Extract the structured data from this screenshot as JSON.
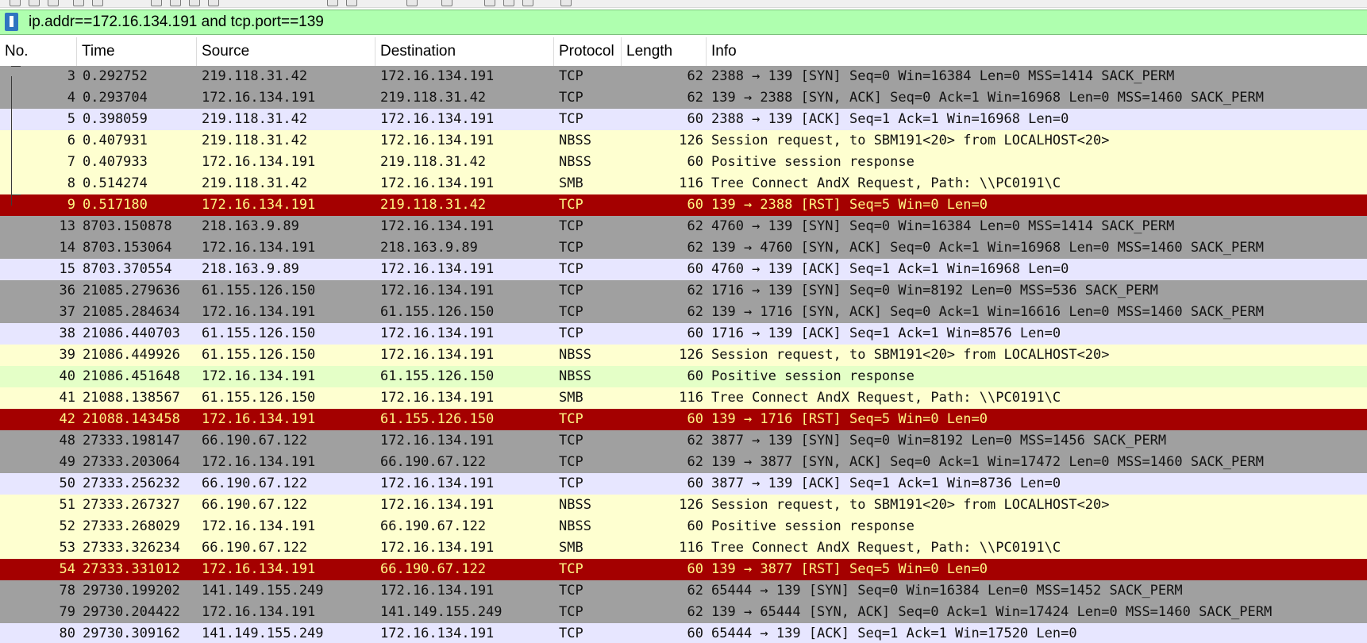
{
  "filter": {
    "value": "ip.addr==172.16.134.191 and tcp.port==139"
  },
  "columns": [
    "No.",
    "Time",
    "Source",
    "Destination",
    "Protocol",
    "Length",
    "Info"
  ],
  "colors": {
    "rst_bg": "#a40000",
    "rst_fg": "#fff785",
    "syn_bg": "#a0a0a0",
    "ack_bg": "#e7e6ff",
    "nbss_bg": "#feffd0",
    "nbss_alt_bg": "#e4ffc7",
    "filter_bg": "#afffaf"
  },
  "packets": [
    {
      "no": "3",
      "time": "0.292752",
      "src": "219.118.31.42",
      "dst": "172.16.134.191",
      "proto": "TCP",
      "len": "62",
      "info": "2388 → 139 [SYN] Seq=0 Win=16384 Len=0 MSS=1414 SACK_PERM",
      "style": "syn",
      "bracket": "start"
    },
    {
      "no": "4",
      "time": "0.293704",
      "src": "172.16.134.191",
      "dst": "219.118.31.42",
      "proto": "TCP",
      "len": "62",
      "info": "139 → 2388 [SYN, ACK] Seq=0 Ack=1 Win=16968 Len=0 MSS=1460 SACK_PERM",
      "style": "syn",
      "bracket": "mid"
    },
    {
      "no": "5",
      "time": "0.398059",
      "src": "219.118.31.42",
      "dst": "172.16.134.191",
      "proto": "TCP",
      "len": "60",
      "info": "2388 → 139 [ACK] Seq=1 Ack=1 Win=16968 Len=0",
      "style": "ack",
      "bracket": "mid"
    },
    {
      "no": "6",
      "time": "0.407931",
      "src": "219.118.31.42",
      "dst": "172.16.134.191",
      "proto": "NBSS",
      "len": "126",
      "info": "Session request, to SBM191<20> from LOCALHOST<20>",
      "style": "nbss",
      "bracket": "mid"
    },
    {
      "no": "7",
      "time": "0.407933",
      "src": "172.16.134.191",
      "dst": "219.118.31.42",
      "proto": "NBSS",
      "len": "60",
      "info": "Positive session response",
      "style": "nbss",
      "bracket": "mid"
    },
    {
      "no": "8",
      "time": "0.514274",
      "src": "219.118.31.42",
      "dst": "172.16.134.191",
      "proto": "SMB",
      "len": "116",
      "info": "Tree Connect AndX Request, Path: \\\\PC0191\\C",
      "style": "nbss",
      "bracket": "mid"
    },
    {
      "no": "9",
      "time": "0.517180",
      "src": "172.16.134.191",
      "dst": "219.118.31.42",
      "proto": "TCP",
      "len": "60",
      "info": "139 → 2388 [RST] Seq=5 Win=0 Len=0",
      "style": "rst",
      "bracket": "end"
    },
    {
      "no": "13",
      "time": "8703.150878",
      "src": "218.163.9.89",
      "dst": "172.16.134.191",
      "proto": "TCP",
      "len": "62",
      "info": "4760 → 139 [SYN] Seq=0 Win=16384 Len=0 MSS=1414 SACK_PERM",
      "style": "syn",
      "bracket": ""
    },
    {
      "no": "14",
      "time": "8703.153064",
      "src": "172.16.134.191",
      "dst": "218.163.9.89",
      "proto": "TCP",
      "len": "62",
      "info": "139 → 4760 [SYN, ACK] Seq=0 Ack=1 Win=16968 Len=0 MSS=1460 SACK_PERM",
      "style": "syn",
      "bracket": ""
    },
    {
      "no": "15",
      "time": "8703.370554",
      "src": "218.163.9.89",
      "dst": "172.16.134.191",
      "proto": "TCP",
      "len": "60",
      "info": "4760 → 139 [ACK] Seq=1 Ack=1 Win=16968 Len=0",
      "style": "ack",
      "bracket": ""
    },
    {
      "no": "36",
      "time": "21085.279636",
      "src": "61.155.126.150",
      "dst": "172.16.134.191",
      "proto": "TCP",
      "len": "62",
      "info": "1716 → 139 [SYN] Seq=0 Win=8192 Len=0 MSS=536 SACK_PERM",
      "style": "syn",
      "bracket": ""
    },
    {
      "no": "37",
      "time": "21085.284634",
      "src": "172.16.134.191",
      "dst": "61.155.126.150",
      "proto": "TCP",
      "len": "62",
      "info": "139 → 1716 [SYN, ACK] Seq=0 Ack=1 Win=16616 Len=0 MSS=1460 SACK_PERM",
      "style": "syn",
      "bracket": ""
    },
    {
      "no": "38",
      "time": "21086.440703",
      "src": "61.155.126.150",
      "dst": "172.16.134.191",
      "proto": "TCP",
      "len": "60",
      "info": "1716 → 139 [ACK] Seq=1 Ack=1 Win=8576 Len=0",
      "style": "ack",
      "bracket": ""
    },
    {
      "no": "39",
      "time": "21086.449926",
      "src": "61.155.126.150",
      "dst": "172.16.134.191",
      "proto": "NBSS",
      "len": "126",
      "info": "Session request, to SBM191<20> from LOCALHOST<20>",
      "style": "nbss",
      "bracket": ""
    },
    {
      "no": "40",
      "time": "21086.451648",
      "src": "172.16.134.191",
      "dst": "61.155.126.150",
      "proto": "NBSS",
      "len": "60",
      "info": "Positive session response",
      "style": "nbss_alt",
      "bracket": ""
    },
    {
      "no": "41",
      "time": "21088.138567",
      "src": "61.155.126.150",
      "dst": "172.16.134.191",
      "proto": "SMB",
      "len": "116",
      "info": "Tree Connect AndX Request, Path: \\\\PC0191\\C",
      "style": "nbss",
      "bracket": ""
    },
    {
      "no": "42",
      "time": "21088.143458",
      "src": "172.16.134.191",
      "dst": "61.155.126.150",
      "proto": "TCP",
      "len": "60",
      "info": "139 → 1716 [RST] Seq=5 Win=0 Len=0",
      "style": "rst",
      "bracket": ""
    },
    {
      "no": "48",
      "time": "27333.198147",
      "src": "66.190.67.122",
      "dst": "172.16.134.191",
      "proto": "TCP",
      "len": "62",
      "info": "3877 → 139 [SYN] Seq=0 Win=8192 Len=0 MSS=1456 SACK_PERM",
      "style": "syn",
      "bracket": ""
    },
    {
      "no": "49",
      "time": "27333.203064",
      "src": "172.16.134.191",
      "dst": "66.190.67.122",
      "proto": "TCP",
      "len": "62",
      "info": "139 → 3877 [SYN, ACK] Seq=0 Ack=1 Win=17472 Len=0 MSS=1460 SACK_PERM",
      "style": "syn",
      "bracket": ""
    },
    {
      "no": "50",
      "time": "27333.256232",
      "src": "66.190.67.122",
      "dst": "172.16.134.191",
      "proto": "TCP",
      "len": "60",
      "info": "3877 → 139 [ACK] Seq=1 Ack=1 Win=8736 Len=0",
      "style": "ack",
      "bracket": ""
    },
    {
      "no": "51",
      "time": "27333.267327",
      "src": "66.190.67.122",
      "dst": "172.16.134.191",
      "proto": "NBSS",
      "len": "126",
      "info": "Session request, to SBM191<20> from LOCALHOST<20>",
      "style": "nbss",
      "bracket": ""
    },
    {
      "no": "52",
      "time": "27333.268029",
      "src": "172.16.134.191",
      "dst": "66.190.67.122",
      "proto": "NBSS",
      "len": "60",
      "info": "Positive session response",
      "style": "nbss",
      "bracket": ""
    },
    {
      "no": "53",
      "time": "27333.326234",
      "src": "66.190.67.122",
      "dst": "172.16.134.191",
      "proto": "SMB",
      "len": "116",
      "info": "Tree Connect AndX Request, Path: \\\\PC0191\\C",
      "style": "nbss",
      "bracket": ""
    },
    {
      "no": "54",
      "time": "27333.331012",
      "src": "172.16.134.191",
      "dst": "66.190.67.122",
      "proto": "TCP",
      "len": "60",
      "info": "139 → 3877 [RST] Seq=5 Win=0 Len=0",
      "style": "rst",
      "bracket": ""
    },
    {
      "no": "78",
      "time": "29730.199202",
      "src": "141.149.155.249",
      "dst": "172.16.134.191",
      "proto": "TCP",
      "len": "62",
      "info": "65444 → 139 [SYN] Seq=0 Win=16384 Len=0 MSS=1452 SACK_PERM",
      "style": "syn",
      "bracket": ""
    },
    {
      "no": "79",
      "time": "29730.204422",
      "src": "172.16.134.191",
      "dst": "141.149.155.249",
      "proto": "TCP",
      "len": "62",
      "info": "139 → 65444 [SYN, ACK] Seq=0 Ack=1 Win=17424 Len=0 MSS=1460 SACK_PERM",
      "style": "syn",
      "bracket": ""
    },
    {
      "no": "80",
      "time": "29730.309162",
      "src": "141.149.155.249",
      "dst": "172.16.134.191",
      "proto": "TCP",
      "len": "60",
      "info": "65444 → 139 [ACK] Seq=1 Ack=1 Win=17520 Len=0",
      "style": "ack",
      "bracket": ""
    }
  ]
}
